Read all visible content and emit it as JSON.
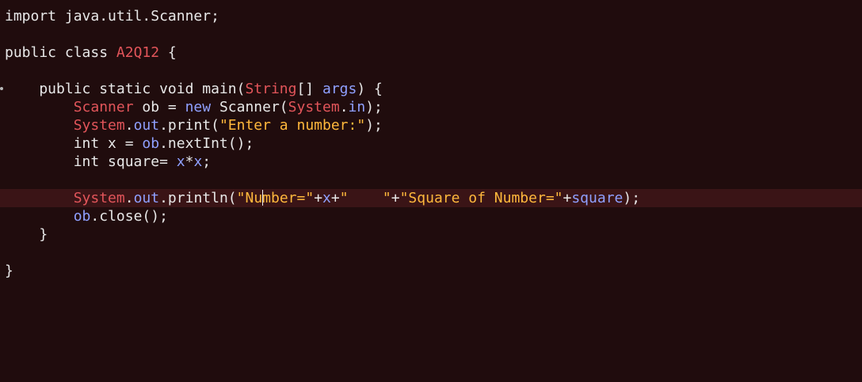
{
  "editor": {
    "colors": {
      "background": "#200c0d",
      "current_line": "#3a1416",
      "plain_text": "#e8e8e8",
      "class_name": "#e2555a",
      "identifier": "#8fa0ff",
      "string": "#ffb83c"
    },
    "lines": [
      {
        "tokens": [
          {
            "t": "import java.util.Scanner;",
            "c": "pl"
          }
        ]
      },
      {
        "tokens": []
      },
      {
        "tokens": [
          {
            "t": "public class ",
            "c": "kw"
          },
          {
            "t": "A2Q12",
            "c": "cls"
          },
          {
            "t": " {",
            "c": "pl"
          }
        ]
      },
      {
        "tokens": []
      },
      {
        "tokens": [
          {
            "t": "    public static void main(",
            "c": "pl"
          },
          {
            "t": "String",
            "c": "cls"
          },
          {
            "t": "[] ",
            "c": "pl"
          },
          {
            "t": "args",
            "c": "fld"
          },
          {
            "t": ") {",
            "c": "pl"
          }
        ],
        "fold_marker": true
      },
      {
        "tokens": [
          {
            "t": "        ",
            "c": "pl"
          },
          {
            "t": "Scanner",
            "c": "cls"
          },
          {
            "t": " ob = ",
            "c": "pl"
          },
          {
            "t": "new",
            "c": "fld"
          },
          {
            "t": " Scanner(",
            "c": "pl"
          },
          {
            "t": "System",
            "c": "cls"
          },
          {
            "t": ".",
            "c": "pl"
          },
          {
            "t": "in",
            "c": "fld"
          },
          {
            "t": ");",
            "c": "pl"
          }
        ]
      },
      {
        "tokens": [
          {
            "t": "        ",
            "c": "pl"
          },
          {
            "t": "System",
            "c": "cls"
          },
          {
            "t": ".",
            "c": "pl"
          },
          {
            "t": "out",
            "c": "fld"
          },
          {
            "t": ".print(",
            "c": "pl"
          },
          {
            "t": "\"Enter a number:\"",
            "c": "str"
          },
          {
            "t": ");",
            "c": "pl"
          }
        ]
      },
      {
        "tokens": [
          {
            "t": "        int x = ",
            "c": "pl"
          },
          {
            "t": "ob",
            "c": "fld"
          },
          {
            "t": ".nextInt();",
            "c": "pl"
          }
        ]
      },
      {
        "tokens": [
          {
            "t": "        int square= ",
            "c": "pl"
          },
          {
            "t": "x",
            "c": "fld"
          },
          {
            "t": "*",
            "c": "pl"
          },
          {
            "t": "x",
            "c": "fld"
          },
          {
            "t": ";",
            "c": "pl"
          }
        ]
      },
      {
        "tokens": []
      },
      {
        "tokens": [
          {
            "t": "        ",
            "c": "pl"
          },
          {
            "t": "System",
            "c": "cls"
          },
          {
            "t": ".",
            "c": "pl"
          },
          {
            "t": "out",
            "c": "fld"
          },
          {
            "t": ".println(",
            "c": "pl"
          },
          {
            "t": "\"Nu",
            "c": "str"
          },
          {
            "t": "",
            "c": "cursor"
          },
          {
            "t": "mber=\"",
            "c": "str"
          },
          {
            "t": "+",
            "c": "pl"
          },
          {
            "t": "x",
            "c": "fld"
          },
          {
            "t": "+",
            "c": "pl"
          },
          {
            "t": "\"    \"",
            "c": "str"
          },
          {
            "t": "+",
            "c": "pl"
          },
          {
            "t": "\"Square of Number=\"",
            "c": "str"
          },
          {
            "t": "+",
            "c": "pl"
          },
          {
            "t": "square",
            "c": "fld"
          },
          {
            "t": ");",
            "c": "pl"
          }
        ],
        "current": true
      },
      {
        "tokens": [
          {
            "t": "        ",
            "c": "pl"
          },
          {
            "t": "ob",
            "c": "fld"
          },
          {
            "t": ".close();",
            "c": "pl"
          }
        ]
      },
      {
        "tokens": [
          {
            "t": "    }",
            "c": "pl"
          }
        ]
      },
      {
        "tokens": []
      },
      {
        "tokens": [
          {
            "t": "}",
            "c": "pl"
          }
        ]
      }
    ]
  }
}
